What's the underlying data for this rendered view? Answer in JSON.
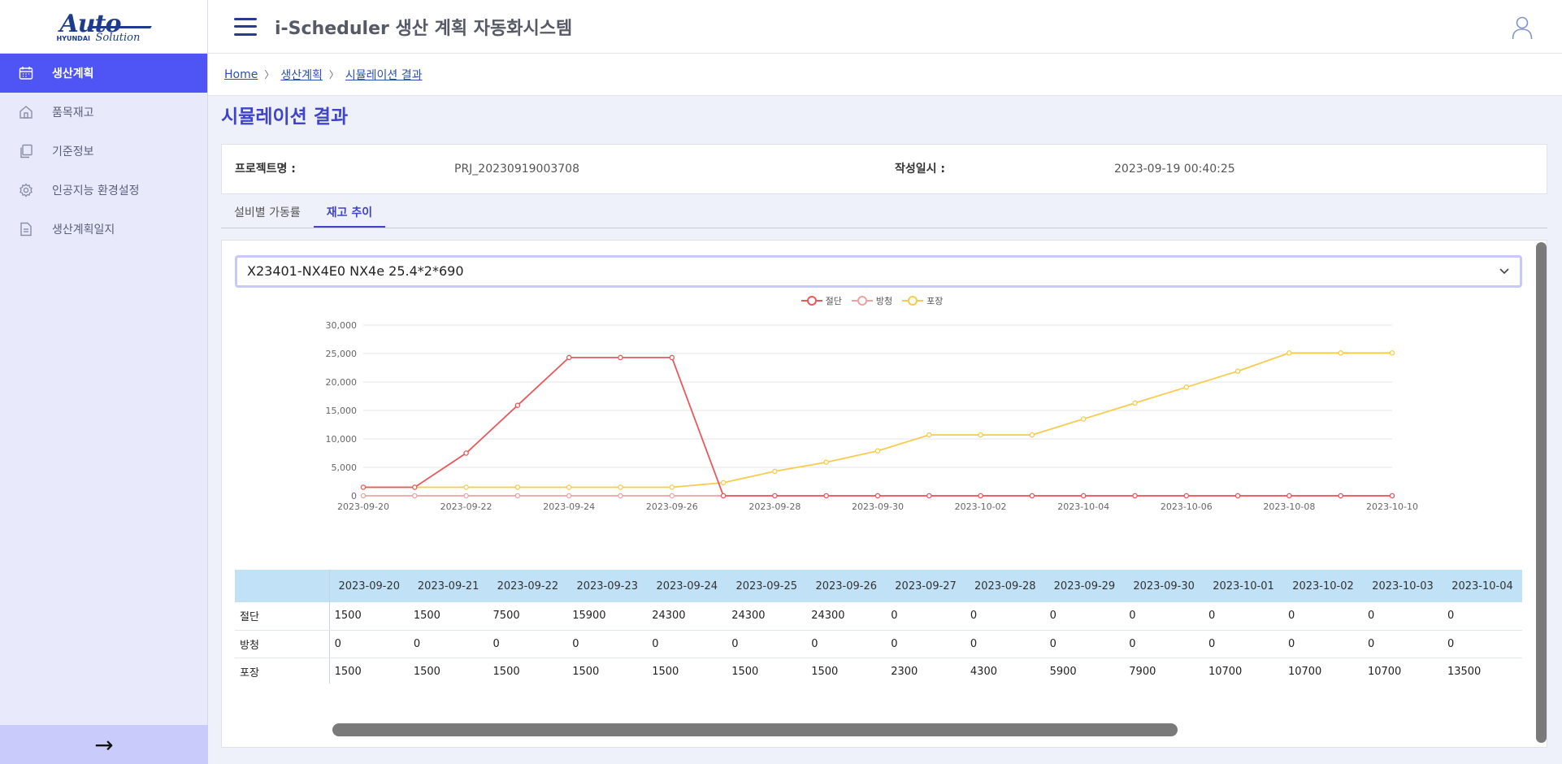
{
  "logo": {
    "brand_main": "Auto",
    "brand_sub": "Solution",
    "brand_small": "HYUNDAI"
  },
  "app": {
    "title": "i-Scheduler 생산 계획 자동화시스템"
  },
  "sidebar": {
    "items": [
      {
        "label": "생산계획",
        "icon": "calendar-icon",
        "active": true
      },
      {
        "label": "품목재고",
        "icon": "home-icon",
        "active": false
      },
      {
        "label": "기준정보",
        "icon": "copy-icon",
        "active": false
      },
      {
        "label": "인공지능 환경설정",
        "icon": "gear-icon",
        "active": false
      },
      {
        "label": "생산계획일지",
        "icon": "document-icon",
        "active": false
      }
    ],
    "footer_arrow": "→"
  },
  "breadcrumb": [
    "Home",
    "생산계획",
    "시뮬레이션 결과"
  ],
  "page": {
    "title": "시뮬레이션 결과"
  },
  "info": {
    "project_label": "프로젝트명 :",
    "project_value": "PRJ_20230919003708",
    "created_label": "작성일시 :",
    "created_value": "2023-09-19 00:40:25"
  },
  "tabs": [
    {
      "label": "설비별 가동률",
      "active": false
    },
    {
      "label": "재고 추이",
      "active": true
    }
  ],
  "select": {
    "value": "X23401-NX4E0 NX4e 25.4*2*690"
  },
  "colors": {
    "accent": "#4f55f5",
    "cut": "#e8585c",
    "rust": "#f0a0a0",
    "pack": "#f7cb4d"
  },
  "chart_data": {
    "type": "line",
    "x": [
      "2023-09-20",
      "2023-09-21",
      "2023-09-22",
      "2023-09-23",
      "2023-09-24",
      "2023-09-25",
      "2023-09-26",
      "2023-09-27",
      "2023-09-28",
      "2023-09-29",
      "2023-09-30",
      "2023-10-01",
      "2023-10-02",
      "2023-10-03",
      "2023-10-04",
      "2023-10-05",
      "2023-10-06",
      "2023-10-07",
      "2023-10-08",
      "2023-10-09",
      "2023-10-10"
    ],
    "series": [
      {
        "name": "절단",
        "color": "#e8585c",
        "values": [
          1500,
          1500,
          7500,
          15900,
          24300,
          24300,
          24300,
          0,
          0,
          0,
          0,
          0,
          0,
          0,
          0,
          0,
          0,
          0,
          0,
          0,
          0
        ]
      },
      {
        "name": "방청",
        "color": "#f0a0a0",
        "values": [
          0,
          0,
          0,
          0,
          0,
          0,
          0,
          0,
          0,
          0,
          0,
          0,
          0,
          0,
          0,
          0,
          0,
          0,
          0,
          0,
          0
        ]
      },
      {
        "name": "포장",
        "color": "#f7cb4d",
        "values": [
          1500,
          1500,
          1500,
          1500,
          1500,
          1500,
          1500,
          2300,
          4300,
          5900,
          7900,
          10700,
          10700,
          10700,
          13500,
          16300,
          19100,
          21900,
          25100,
          25100,
          25100
        ]
      }
    ],
    "yticks": [
      "0",
      "5,000",
      "10,000",
      "15,000",
      "20,000",
      "25,000",
      "30,000"
    ],
    "xtick_labels": [
      "2023-09-20",
      "2023-09-22",
      "2023-09-24",
      "2023-09-26",
      "2023-09-28",
      "2023-09-30",
      "2023-10-02",
      "2023-10-04",
      "2023-10-06",
      "2023-10-08",
      "2023-10-10"
    ],
    "ylim": [
      0,
      30000
    ],
    "grid": true,
    "legend": "top-center"
  },
  "table": {
    "columns": [
      "2023-09-20",
      "2023-09-21",
      "2023-09-22",
      "2023-09-23",
      "2023-09-24",
      "2023-09-25",
      "2023-09-26",
      "2023-09-27",
      "2023-09-28",
      "2023-09-29",
      "2023-09-30",
      "2023-10-01",
      "2023-10-02",
      "2023-10-03",
      "2023-10-04"
    ],
    "rows": [
      {
        "label": "절단",
        "values": [
          "1500",
          "1500",
          "7500",
          "15900",
          "24300",
          "24300",
          "24300",
          "0",
          "0",
          "0",
          "0",
          "0",
          "0",
          "0",
          "0"
        ]
      },
      {
        "label": "방청",
        "values": [
          "0",
          "0",
          "0",
          "0",
          "0",
          "0",
          "0",
          "0",
          "0",
          "0",
          "0",
          "0",
          "0",
          "0",
          "0"
        ]
      },
      {
        "label": "포장",
        "values": [
          "1500",
          "1500",
          "1500",
          "1500",
          "1500",
          "1500",
          "1500",
          "2300",
          "4300",
          "5900",
          "7900",
          "10700",
          "10700",
          "10700",
          "13500"
        ]
      }
    ]
  }
}
